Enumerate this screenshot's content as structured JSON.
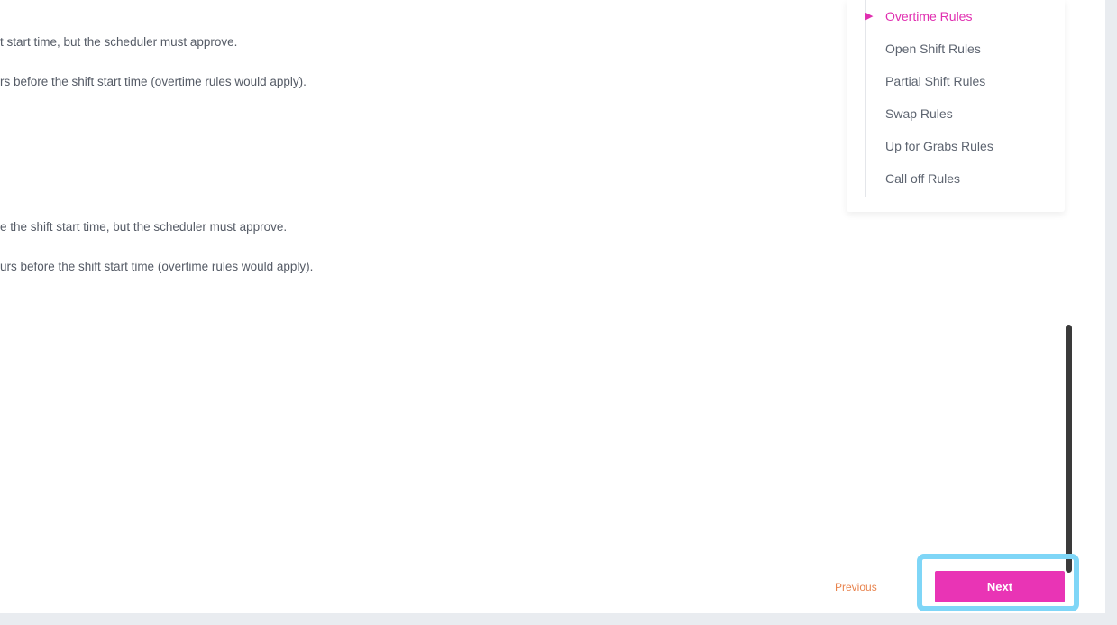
{
  "content": {
    "paragraphs": [
      "t start time, but the scheduler must approve.",
      "rs before the shift start time (overtime rules would apply).",
      "e the shift start time, but the scheduler must approve.",
      "urs before the shift start time (overtime rules would apply)."
    ]
  },
  "toc": {
    "active_marker": "▶",
    "items": [
      {
        "label": "Overtime Rules",
        "active": true
      },
      {
        "label": "Open Shift Rules"
      },
      {
        "label": "Partial Shift Rules"
      },
      {
        "label": "Swap Rules"
      },
      {
        "label": "Up for Grabs Rules"
      },
      {
        "label": "Call off Rules"
      }
    ]
  },
  "pagination": {
    "previous_label": "Previous",
    "next_label": "Next"
  },
  "colors": {
    "accent": "#e934b5",
    "previous_link": "#e8834d",
    "highlight": "#7fd6f7"
  }
}
